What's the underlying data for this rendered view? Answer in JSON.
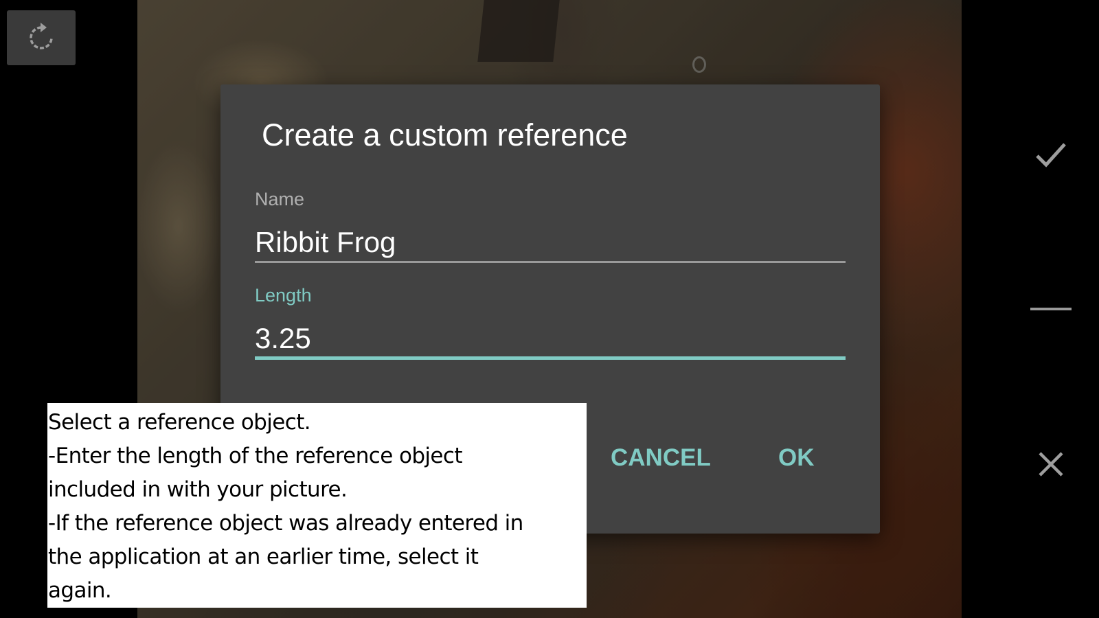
{
  "dialog": {
    "title": "Create a custom reference",
    "name_label": "Name",
    "name_value": "Ribbit Frog",
    "length_label": "Length",
    "length_value": "3.25",
    "cancel_label": "CANCEL",
    "ok_label": "OK"
  },
  "help": {
    "lines": [
      "Select a reference object.",
      "-Enter the length of the reference object",
      "included in with your picture.",
      "-If the reference object was already entered in",
      "the application at an earlier time, select it",
      "again."
    ]
  },
  "controls": {
    "left": [
      "rotate-icon"
    ],
    "right": [
      "check-icon",
      "minus-icon",
      "close-icon"
    ]
  },
  "colors": {
    "accent": "#80cbc4",
    "dialog_bg": "#424242",
    "side_bg": "#000000",
    "icon_gray": "#9e9e9e"
  }
}
